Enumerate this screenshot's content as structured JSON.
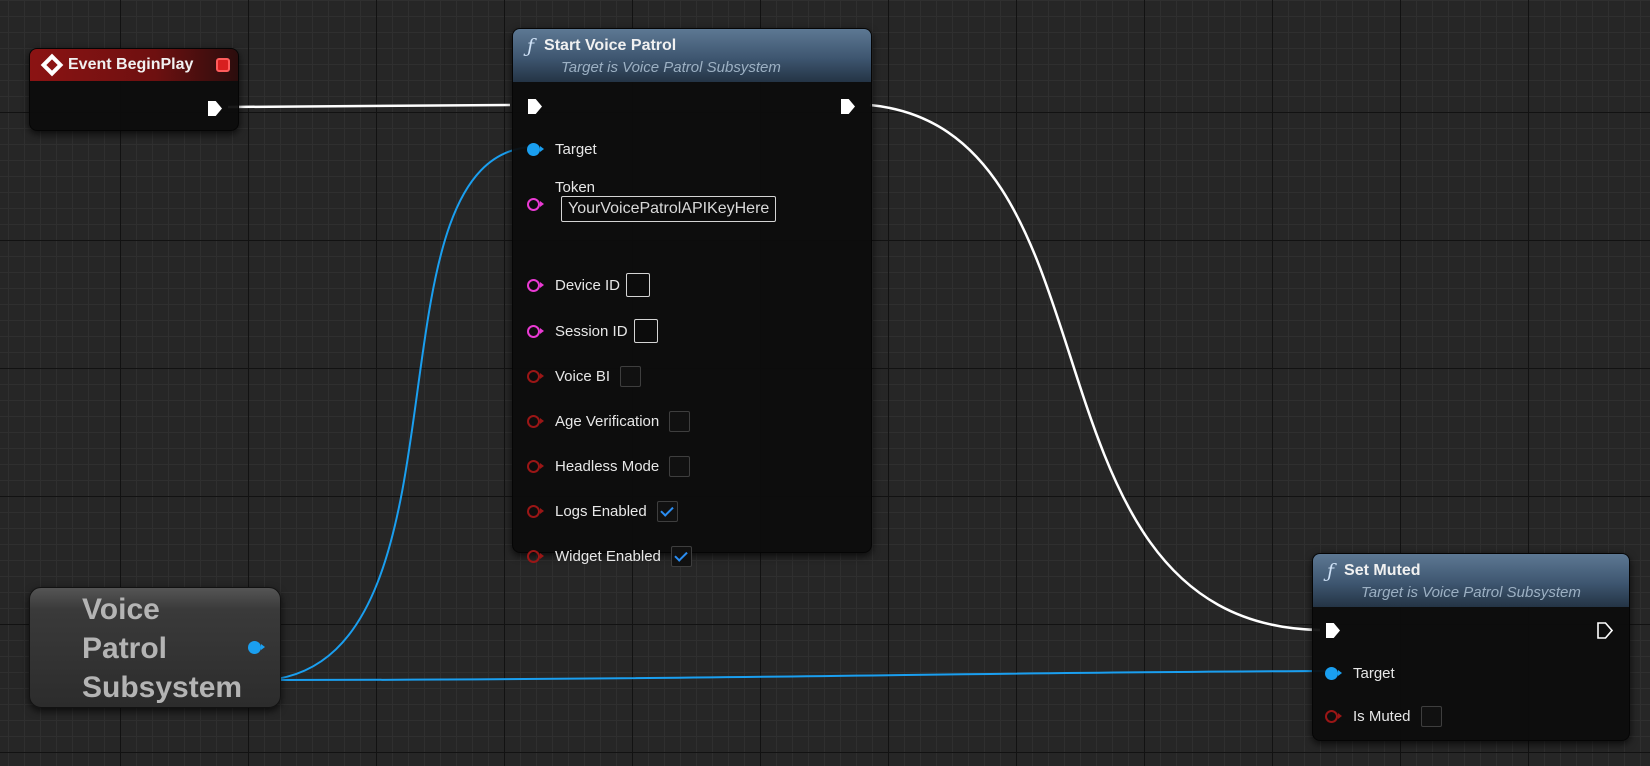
{
  "nodes": {
    "event_begin_play": {
      "title": "Event BeginPlay"
    },
    "start_voice_patrol": {
      "icon": "function-icon",
      "title": "Start Voice Patrol",
      "subtitle": "Target is Voice Patrol Subsystem",
      "pins": {
        "target_label": "Target",
        "token_label": "Token",
        "token_value": "YourVoicePatrolAPIKeyHere",
        "device_id_label": "Device ID",
        "device_id_value": "",
        "session_id_label": "Session ID",
        "session_id_value": "",
        "voice_bi_label": "Voice BI",
        "voice_bi_checked": false,
        "age_verification_label": "Age Verification",
        "age_verification_checked": false,
        "headless_mode_label": "Headless Mode",
        "headless_mode_checked": false,
        "logs_enabled_label": "Logs Enabled",
        "logs_enabled_checked": true,
        "widget_enabled_label": "Widget Enabled",
        "widget_enabled_checked": true
      }
    },
    "set_muted": {
      "icon": "function-icon",
      "title": "Set Muted",
      "subtitle": "Target is Voice Patrol Subsystem",
      "pins": {
        "target_label": "Target",
        "is_muted_label": "Is Muted",
        "is_muted_checked": false
      }
    },
    "voice_patrol_subsystem": {
      "title": "Voice Patrol Subsystem"
    }
  },
  "colors": {
    "grid_background": "#262626",
    "event_header": "#8b1313",
    "function_header": "#3e5670",
    "exec_wire": "#ffffff",
    "object_pin": "#1a9ff0",
    "string_pin": "#e93ad3",
    "bool_pin": "#9a1616",
    "checkbox_check": "#2a8df2"
  }
}
